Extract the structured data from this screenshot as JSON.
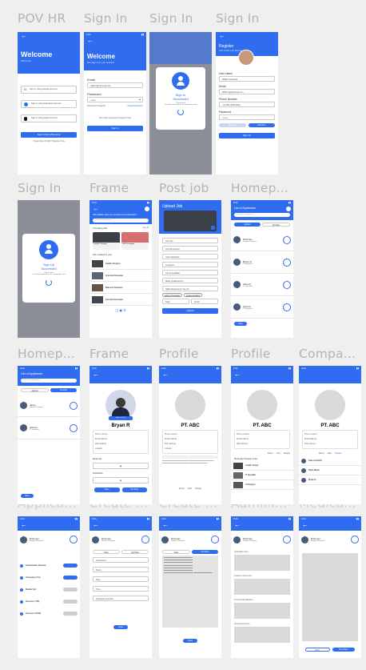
{
  "labels": [
    "POV HR",
    "Sign In",
    "Sign In",
    "Sign In",
    "Sign In",
    "Frame",
    "Post job",
    "Homep...",
    "Homep...",
    "Frame",
    "Profile",
    "Profile",
    "Compa...",
    "Applica...",
    "Create ...",
    "Create ...",
    "Admini...",
    "Medica..."
  ],
  "welcome": {
    "title": "Welcome",
    "sub": "Welcome!",
    "google": "Sign in Using Google Account",
    "facebook": "Sign In Using Facebook Account",
    "apple": "Sign In Using Apple Account",
    "btn": "Sign In Using Personal",
    "link": "Create New Profile? Register Now"
  },
  "signin": {
    "title": "Welcome",
    "sub": "let's sign in to your account",
    "email_label": "Email",
    "email": "william@dummail.com",
    "password_label": "Password",
    "password": "••••••••",
    "remember": "Remember Password",
    "forgot": "Forgot Password?",
    "no_acc": "Don't have an account? Register Now",
    "btn": "Sign In"
  },
  "success": {
    "title": "Sign In",
    "title2": "Successful",
    "note": "Please wait",
    "note2": "You will be directed to the homepage soon"
  },
  "register": {
    "title": "Register",
    "sub": "Let's create your account",
    "user_label": "User Name",
    "user": "William Hawutse",
    "email_label": "Email",
    "email": "William@dummail.com",
    "phone_label": "Phone Number",
    "phone": "+62 831-3456-8222",
    "password_label": "Password",
    "password": "••••••••",
    "tab1": "Applicant",
    "tab2": "Institution",
    "btn": "Sign Up"
  },
  "signup": {
    "title": "Sign Up",
    "title2": "Successful",
    "note": "Please wait",
    "note2": "You will be directed to the homepage soon"
  },
  "frame": {
    "hello": "Hello William, have you completed your application?",
    "search": "Search for jobs here",
    "trending": "Trending jobs",
    "see_all": "See all",
    "job1": "Graphic Designer",
    "job2": "UI/UX Designer",
    "nearby": "Job related to you",
    "items": [
      "Graphic Designer",
      "Front-End Developer",
      "Back-end Developer",
      "Front-End Developer"
    ]
  },
  "post": {
    "title": "Upload Job",
    "fields": [
      "Job Title",
      "Job Description",
      "Jobs Highlights",
      "Locations",
      "Job Is Available",
      "Make Qualifications",
      "Skills Required for the job"
    ],
    "tags": [
      "Adobe Photoshop",
      "Adobe Illustrator"
    ],
    "start": "Start",
    "finish": "Finish",
    "btn": "Upload"
  },
  "home": {
    "title": "List of Applicants",
    "search": "Search for applicants",
    "tab1": "Applied",
    "tab2": "Pending",
    "people": [
      {
        "name": "Richman",
        "role": "Graphic Designer"
      },
      {
        "name": "Bryan R",
        "role": "IT Specialist"
      },
      {
        "name": "Ahmad",
        "role": "IT Specialist"
      },
      {
        "name": "Ahmad",
        "role": "IT Specialist"
      }
    ],
    "btn": "Open"
  },
  "home2": {
    "people": [
      {
        "name": "Jason",
        "role": "Graphic Designer"
      },
      {
        "name": "Ahmad",
        "role": "IT Specialist"
      }
    ],
    "btn": "Back"
  },
  "profile_bryan": {
    "name": "Bryan R",
    "tag": "Open to Work",
    "items": [
      "Phone number",
      "Email address",
      "Web address",
      "Linkedin"
    ],
    "resume": "Resume",
    "portfolio": "Portofolio",
    "pass": "Pass",
    "notpass": "Not Pass"
  },
  "company": {
    "name": "PT. ABC",
    "items": [
      "Phone number",
      "Email address",
      "Web address",
      "Linkedin"
    ],
    "tabs": [
      "About",
      "Jobs",
      "People"
    ],
    "recent": "Recently Posted Jobs",
    "jobs": [
      "Graphic Design",
      "IT Specialist",
      "UI Designer"
    ],
    "people": [
      "Take control/hr",
      "Shari Martin",
      "Bryan R"
    ]
  },
  "apply": {
    "name": "Richman",
    "role": "Graphic Designer",
    "steps": [
      "Administration Selection",
      "Competency Test",
      "Medical Test",
      "Interview 1 (HR)",
      "Interview 2 (HOD)"
    ]
  },
  "create": {
    "form": [
      "Interviewer",
      "Room",
      "Days",
      "Time",
      "Participant Number"
    ],
    "btn": "Send",
    "tab1": "Pass",
    "tab2": "Not Pass"
  },
  "admin": {
    "items": [
      "Application letter",
      "Academic Document",
      "Personal Identification",
      "Special Document"
    ]
  },
  "medical": {
    "back": "Back",
    "send": "Send Back"
  }
}
